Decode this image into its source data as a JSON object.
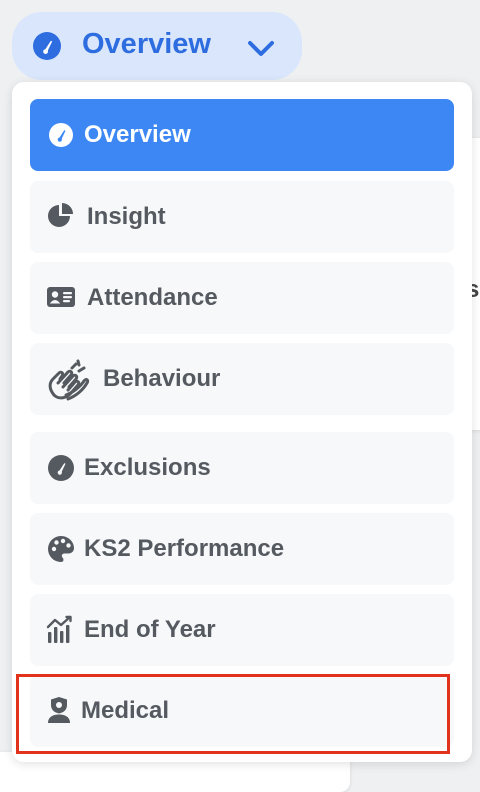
{
  "trigger": {
    "label": "Overview",
    "icon": "gauge-icon",
    "chevron": "chevron-down-icon"
  },
  "menu": {
    "items": [
      {
        "label": "Overview",
        "icon": "gauge-icon",
        "active": true
      },
      {
        "label": "Insight",
        "icon": "pie-chart-icon"
      },
      {
        "label": "Attendance",
        "icon": "id-card-icon"
      },
      {
        "label": "Behaviour",
        "icon": "clapping-hands-icon"
      },
      {
        "label": "Exclusions",
        "icon": "gauge-icon"
      },
      {
        "label": "KS2 Performance",
        "icon": "palette-icon"
      },
      {
        "label": "End of Year",
        "icon": "bar-chart-trend-icon"
      },
      {
        "label": "Medical",
        "icon": "user-shield-icon",
        "highlighted": true
      }
    ]
  },
  "background": {
    "partial_text": "se"
  },
  "colors": {
    "accent": "#3d87f5",
    "trigger_bg": "#d9e6fb",
    "trigger_text": "#2e6de0",
    "highlight": "#e2321c"
  }
}
